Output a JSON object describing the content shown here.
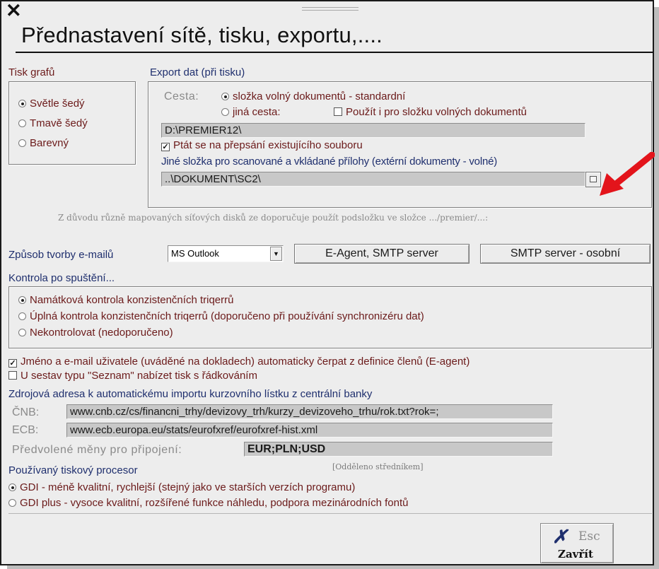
{
  "window": {
    "close_glyph": "✕",
    "title": "Přednastavení sítě, tisku, exportu,...."
  },
  "tisk_grafu": {
    "legend": "Tisk grafů",
    "options": [
      "Světle šedý",
      "Tmavě šedý",
      "Barevný"
    ],
    "selected": "Světle šedý"
  },
  "export": {
    "legend": "Export dat (při tisku)",
    "cesta_label": "Cesta:",
    "cesta_options": [
      "složka volný dokumentů - standardní",
      "jiná cesta:"
    ],
    "cesta_selected": "složka volný dokumentů - standardní",
    "pouzit_label": "Použít i pro složku volných dokumentů",
    "pouzit_checked": false,
    "path_value": "D:\\PREMIER12\\",
    "ptat_label": "Ptát se na přepsání existujícího souboru",
    "ptat_checked": true,
    "jine_label": "Jiné složka pro scanované a vkládané přílohy (extérní dokumenty - volné)",
    "scan_path_value": "..\\DOKUMENT\\SC2\\",
    "browse_icon": "folder-browse-icon"
  },
  "network_note": "Z důvodu různě mapovaných síťových disků ze doporučuje použít podsložku ve složce .../premier/...:",
  "email": {
    "label": "Způsob tvorby e-mailů",
    "selected": "MS Outlook",
    "eagent_button": "E-Agent, SMTP server",
    "smtp_button": "SMTP server - osobní"
  },
  "kontrola": {
    "legend": "Kontrola po spuštění...",
    "options": [
      "Namátková kontrola konzistenčních triqerrů",
      "Úplná kontrola konzistenčních triqerrů (doporučeno při používání synchronizéru dat)",
      "Nekontrolovat (nedoporučeno)"
    ],
    "selected": "Namátková kontrola konzistenčních triqerrů"
  },
  "checks": {
    "jmeno_label": "Jméno a e-mail uživatele (uváděné na dokladech) automaticky čerpat z definice členů (E-agent)",
    "jmeno_checked": true,
    "seznam_label": "U sestav typu \"Seznam\" nabízet tisk s řádkováním",
    "seznam_checked": false
  },
  "kurzy": {
    "heading": "Zdrojová adresa k automatickému importu kurzovního lístku z centrální banky",
    "cnb_label": "ČNB:",
    "cnb_url": "www.cnb.cz/cs/financni_trhy/devizovy_trh/kurzy_devizoveho_trhu/rok.txt?rok=;",
    "ecb_label": "ECB:",
    "ecb_url": "www.ecb.europa.eu/stats/eurofxref/eurofxref-hist.xml",
    "meny_label": "Předvolené měny pro připojení:",
    "meny_value": "EUR;PLN;USD",
    "meny_note": "[Odděleno středníkem]"
  },
  "procesor": {
    "legend": "Používaný tiskový procesor",
    "options": [
      "GDI - méně kvalitní, rychlejší (stejný jako ve starších verzích programu)",
      "GDI plus - vysoce kvalitní, rozšířené funkce náhledu, podpora mezinárodních fontů"
    ],
    "selected": "GDI - méně kvalitní, rychlejší (stejný jako ve starších verzích programu)"
  },
  "close_button": {
    "icon": "x-mark-icon",
    "shortcut": "Esc",
    "label": "Zavřít"
  },
  "colors": {
    "label_maroon": "#6b1a1a",
    "label_navy": "#1f2f6e",
    "arrow_red": "#e3141b",
    "field_grey": "#c8c8c8",
    "window_bg": "#ededed"
  }
}
